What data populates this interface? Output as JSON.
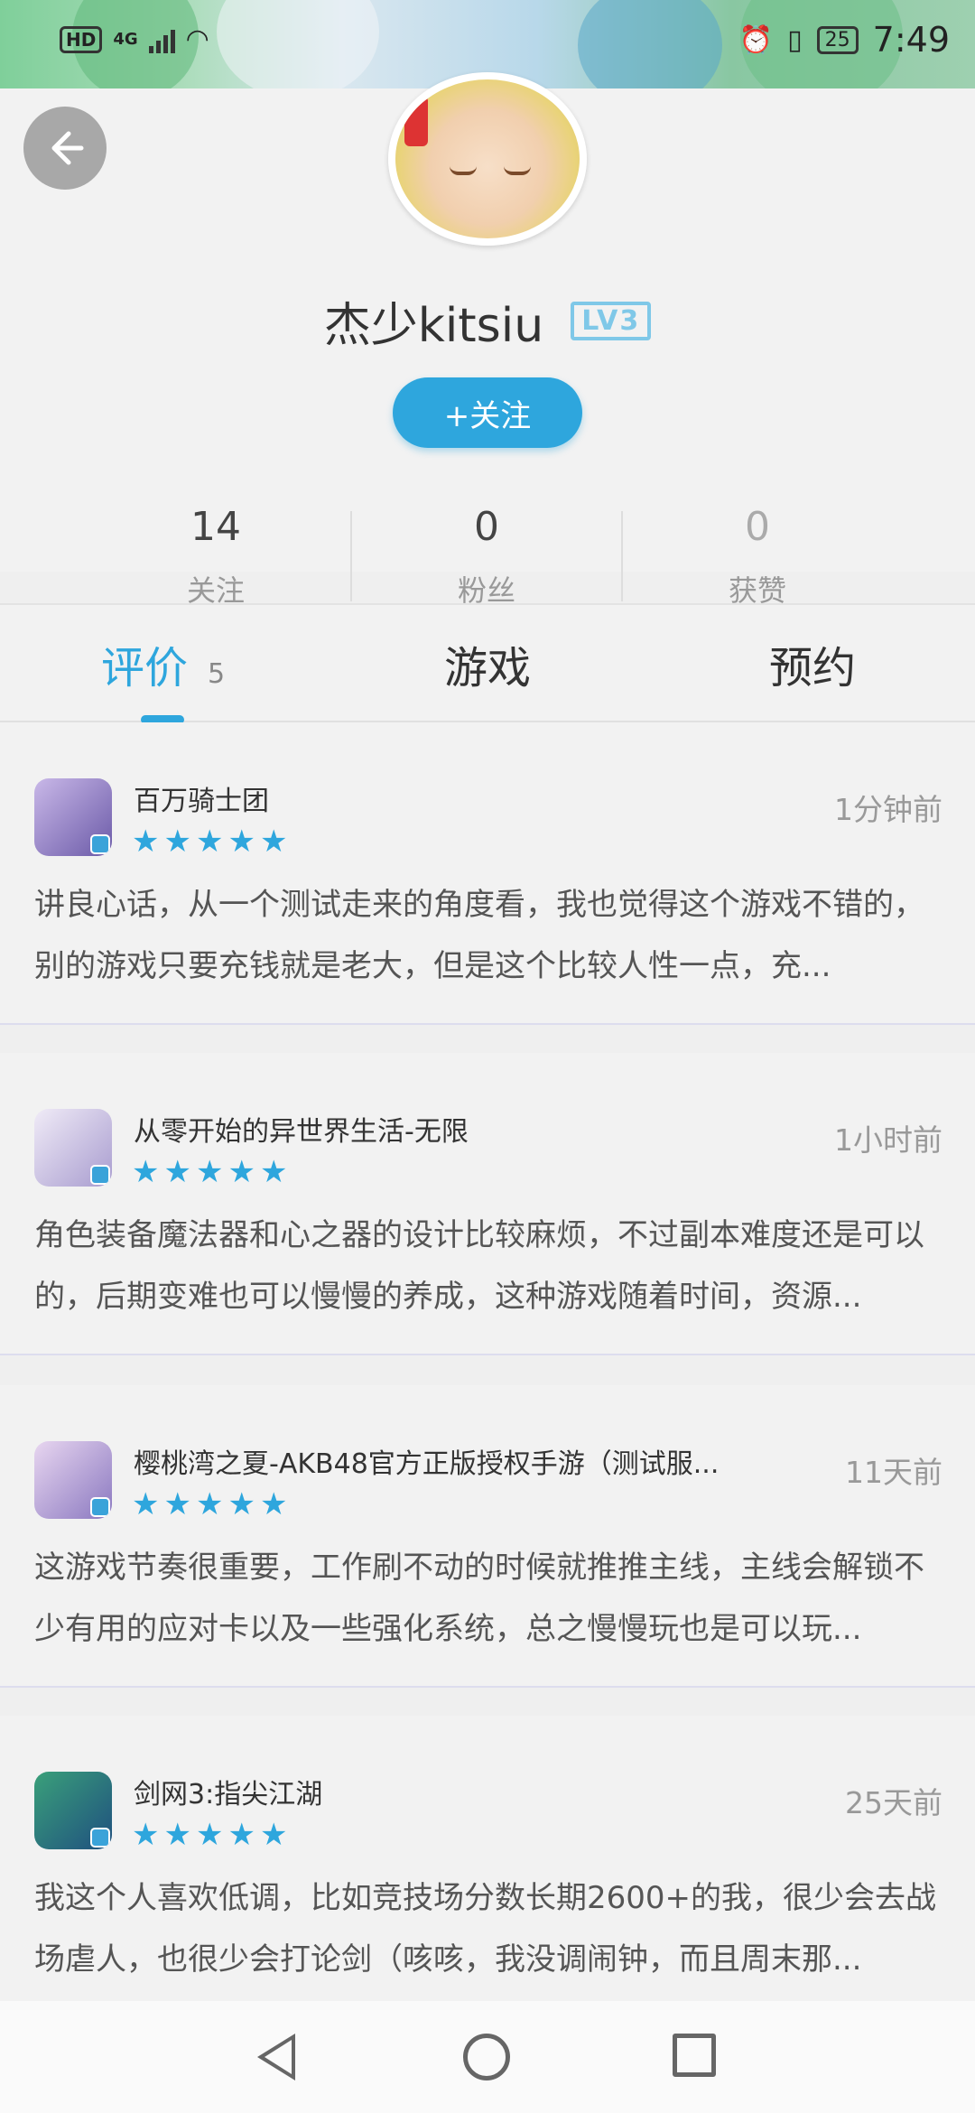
{
  "status_bar": {
    "left_badge": "HD",
    "network": "4G",
    "battery": "25",
    "time": "7:49"
  },
  "profile": {
    "username": "杰少kitsiu",
    "level": "LV3",
    "follow_label": "+关注",
    "stats": [
      {
        "value": "14",
        "label": "关注"
      },
      {
        "value": "0",
        "label": "粉丝"
      },
      {
        "value": "0",
        "label": "获赞"
      }
    ]
  },
  "tabs": [
    {
      "label": "评价",
      "count": "5",
      "active": true
    },
    {
      "label": "游戏"
    },
    {
      "label": "预约"
    }
  ],
  "reviews": [
    {
      "game": "百万骑士团",
      "time": "1分钟前",
      "stars": 5,
      "text": "讲良心话，从一个测试走来的角度看，我也觉得这个游戏不错的，别的游戏只要充钱就是老大，但是这个比较人性一点，充...",
      "icon_colors": [
        "#b7a6d8",
        "#6b5aa8"
      ]
    },
    {
      "game": "从零开始的异世界生活-无限",
      "time": "1小时前",
      "stars": 5,
      "text": "角色装备魔法器和心之器的设计比较麻烦，不过副本难度还是可以的，后期变难也可以慢慢的养成，这种游戏随着时间，资源...",
      "icon_colors": [
        "#e8e0f0",
        "#a89ccf"
      ]
    },
    {
      "game": "樱桃湾之夏-AKB48官方正版授权手游（测试服...",
      "time": "11天前",
      "stars": 5,
      "text": "这游戏节奏很重要，工作刷不动的时候就推推主线，主线会解锁不少有用的应对卡以及一些强化系统，总之慢慢玩也是可以玩...",
      "icon_colors": [
        "#d9c2e6",
        "#8a78c0"
      ]
    },
    {
      "game": "剑网3:指尖江湖",
      "time": "25天前",
      "stars": 5,
      "text": "我这个人喜欢低调，比如竞技场分数长期2600+的我，很少会去战场虐人，也很少会打论剑（咳咳，我没调闹钟，而且周末那...",
      "icon_colors": [
        "#2f8f6f",
        "#1f4f7f"
      ]
    }
  ]
}
